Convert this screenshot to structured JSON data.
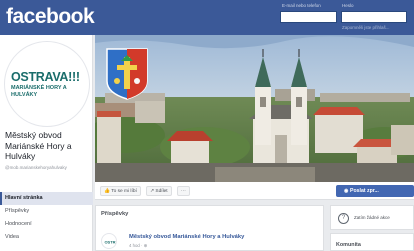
{
  "header": {
    "logo": "facebook",
    "email_label": "E-mail nebo telefon",
    "password_label": "Heslo",
    "forgot_link": "Zapomněli jste přihlaš..."
  },
  "profile": {
    "pic_title": "OSTRAVA!!!",
    "pic_subtitle": "MARIÁNSKÉ HORY A HULVÁKY",
    "page_name": "Městský obvod Mariánské Hory a Hulváky",
    "handle": "@mob.marianskehoryahulvaky"
  },
  "sidebar": {
    "items": [
      {
        "label": "Hlavní stránka",
        "active": true
      },
      {
        "label": "Příspěvky",
        "active": false
      },
      {
        "label": "Hodnocení",
        "active": false
      },
      {
        "label": "Videa",
        "active": false
      }
    ]
  },
  "actions": {
    "like_label": "To se mi líbí",
    "share_label": "Sdílet",
    "more_label": "···",
    "send_label": "Poslat zpr..."
  },
  "posts": {
    "heading": "Příspěvky",
    "author": "Městský obvod Mariánské Hory a Hulváky",
    "meta": "4 hod · "
  },
  "right": {
    "suggest_label": "Zatím žádné akce",
    "suggest_icon": "?",
    "community_heading": "Komunita"
  },
  "colors": {
    "brand_blue": "#3b5998",
    "teal": "#1a6d6b",
    "button_blue": "#4267b2"
  },
  "icons": [
    "like-icon",
    "share-icon",
    "messenger-icon",
    "globe-icon",
    "coat-of-arms-icon"
  ]
}
